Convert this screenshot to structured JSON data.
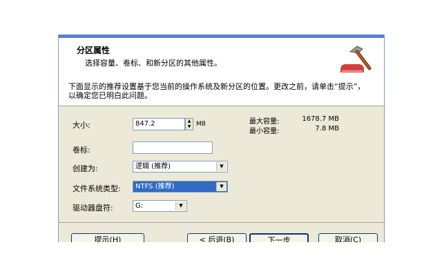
{
  "header": {
    "title": "分区属性",
    "subtitle": "选择容量、卷标、和新分区的其他属性。",
    "icon": "hammer-icon"
  },
  "info_text": "下面显示的推荐设置基于您当前的操作系统及新分区的位置。更改之前，请单击“提示”，以确定您已明白此问题。",
  "fields": {
    "size_label": "大小:",
    "size_value": "847.2",
    "size_unit": "MB",
    "volume_label": "卷标:",
    "volume_value": "",
    "create_as_label": "创建为:",
    "create_as_value": "逻辑 (推荐)",
    "fs_label": "文件系统类型:",
    "fs_value": "NTFS (推荐)",
    "drive_label": "驱动器盘符:",
    "drive_value": "G:"
  },
  "capacity": {
    "max_label": "最大容量:",
    "max_value": "1678.7 MB",
    "min_label": "最小容量:",
    "min_value": "7.8 MB"
  },
  "buttons": {
    "hint": "提示(H)",
    "back": "< 后退(B)",
    "next": "下一步",
    "cancel": "取消(C)"
  },
  "colors": {
    "dialog_bg": "#ece9d8",
    "selection": "#316ac5",
    "title_bar": "#5a7fd1"
  }
}
